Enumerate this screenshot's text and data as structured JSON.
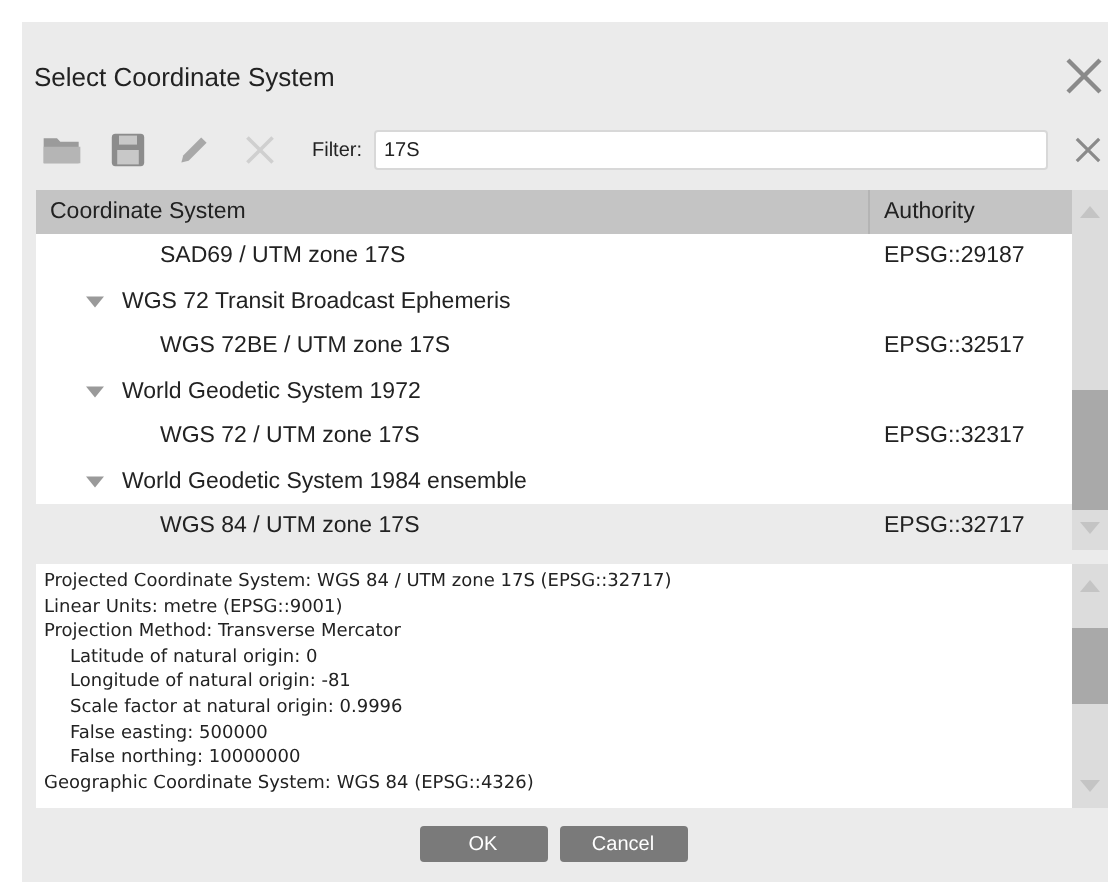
{
  "window": {
    "title": "Select Coordinate System"
  },
  "toolbar": {
    "filter_label": "Filter:",
    "filter_value": "17S"
  },
  "table": {
    "columns": [
      "Coordinate System",
      "Authority"
    ],
    "rows": [
      {
        "name": "SAD69 / UTM zone 17S",
        "authority": "EPSG::29187",
        "selected": false
      },
      {
        "name": "WGS 72 Transit Broadcast Ephemeris",
        "expanded": true,
        "selected": false,
        "children": [
          {
            "name": "WGS 72BE / UTM zone 17S",
            "authority": "EPSG::32517",
            "selected": false
          }
        ]
      },
      {
        "name": "World Geodetic System 1972",
        "expanded": true,
        "selected": false,
        "children": [
          {
            "name": "WGS 72 / UTM zone 17S",
            "authority": "EPSG::32317",
            "selected": false
          }
        ]
      },
      {
        "name": "World Geodetic System 1984 ensemble",
        "expanded": true,
        "selected": false,
        "children": [
          {
            "name": "WGS 84 / UTM zone 17S",
            "authority": "EPSG::32717",
            "selected": true
          }
        ]
      }
    ]
  },
  "details": [
    {
      "text": "Projected Coordinate System: WGS 84 / UTM zone 17S (EPSG::32717)"
    },
    {
      "text": "Linear Units: metre (EPSG::9001)"
    },
    {
      "text": "Projection Method: Transverse Mercator",
      "children": [
        {
          "text": "Latitude of natural origin: 0"
        },
        {
          "text": "Longitude of natural origin: -81"
        },
        {
          "text": "Scale factor at natural origin: 0.9996"
        },
        {
          "text": "False easting: 500000"
        },
        {
          "text": "False northing: 10000000"
        }
      ]
    },
    {
      "text": "Geographic Coordinate System: WGS 84 (EPSG::4326)"
    }
  ],
  "buttons": [
    "OK",
    "Cancel"
  ]
}
